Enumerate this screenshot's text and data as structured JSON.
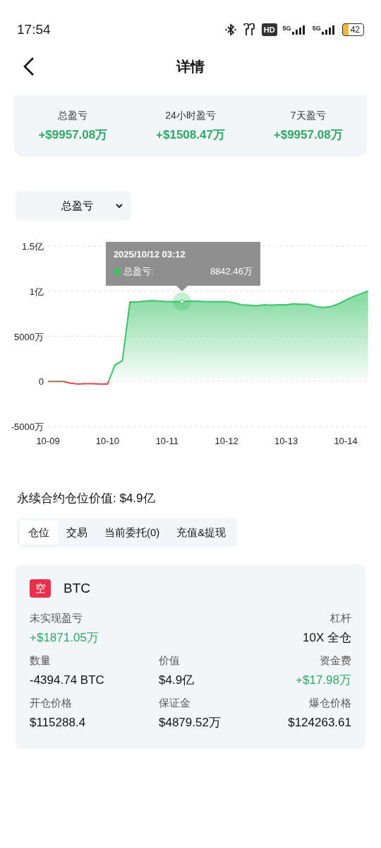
{
  "status_bar": {
    "time": "17:54",
    "hd": "HD",
    "networks": [
      "5G",
      "5G"
    ],
    "battery": "42"
  },
  "header": {
    "title": "详情"
  },
  "summary": [
    {
      "label": "总盈亏",
      "value": "+$9957.08万"
    },
    {
      "label": "24小时盈亏",
      "value": "+$1508.47万"
    },
    {
      "label": "7天盈亏",
      "value": "+$9957.08万"
    }
  ],
  "dropdown": {
    "value": "总盈亏"
  },
  "chart": {
    "y_labels": [
      "1.5亿",
      "1亿",
      "5000万",
      "0",
      "-5000万"
    ],
    "x_labels": [
      "10-09",
      "10-10",
      "10-11",
      "10-12",
      "10-13",
      "10-14"
    ]
  },
  "tooltip": {
    "date": "2025/10/12 03:12",
    "label": "总盈亏:",
    "value": "8842.46万"
  },
  "position_value": "永续合约仓位价值: $4.9亿",
  "tabs": [
    {
      "label": "仓位",
      "selected": true
    },
    {
      "label": "交易",
      "selected": false
    },
    {
      "label": "当前委托(0)",
      "selected": false
    },
    {
      "label": "充值&提现",
      "selected": false
    }
  ],
  "position": {
    "side": "空",
    "symbol": "BTC",
    "rows": [
      [
        {
          "label": "未实现盈亏",
          "value": "+$1871.05万",
          "positive": true
        },
        "",
        {
          "label": "杠杆",
          "value": "10X 全仓",
          "positive": false
        }
      ],
      [
        {
          "label": "数量",
          "value": "-4394.74 BTC",
          "positive": false
        },
        {
          "label": "价值",
          "value": "$4.9亿",
          "positive": false
        },
        {
          "label": "资金费",
          "value": "+$17.98万",
          "positive": true
        }
      ],
      [
        {
          "label": "开仓价格",
          "value": "$115288.4",
          "positive": false
        },
        {
          "label": "保证金",
          "value": "$4879.52万",
          "positive": false
        },
        {
          "label": "爆仓价格",
          "value": "$124263.61",
          "positive": false
        }
      ]
    ]
  }
}
